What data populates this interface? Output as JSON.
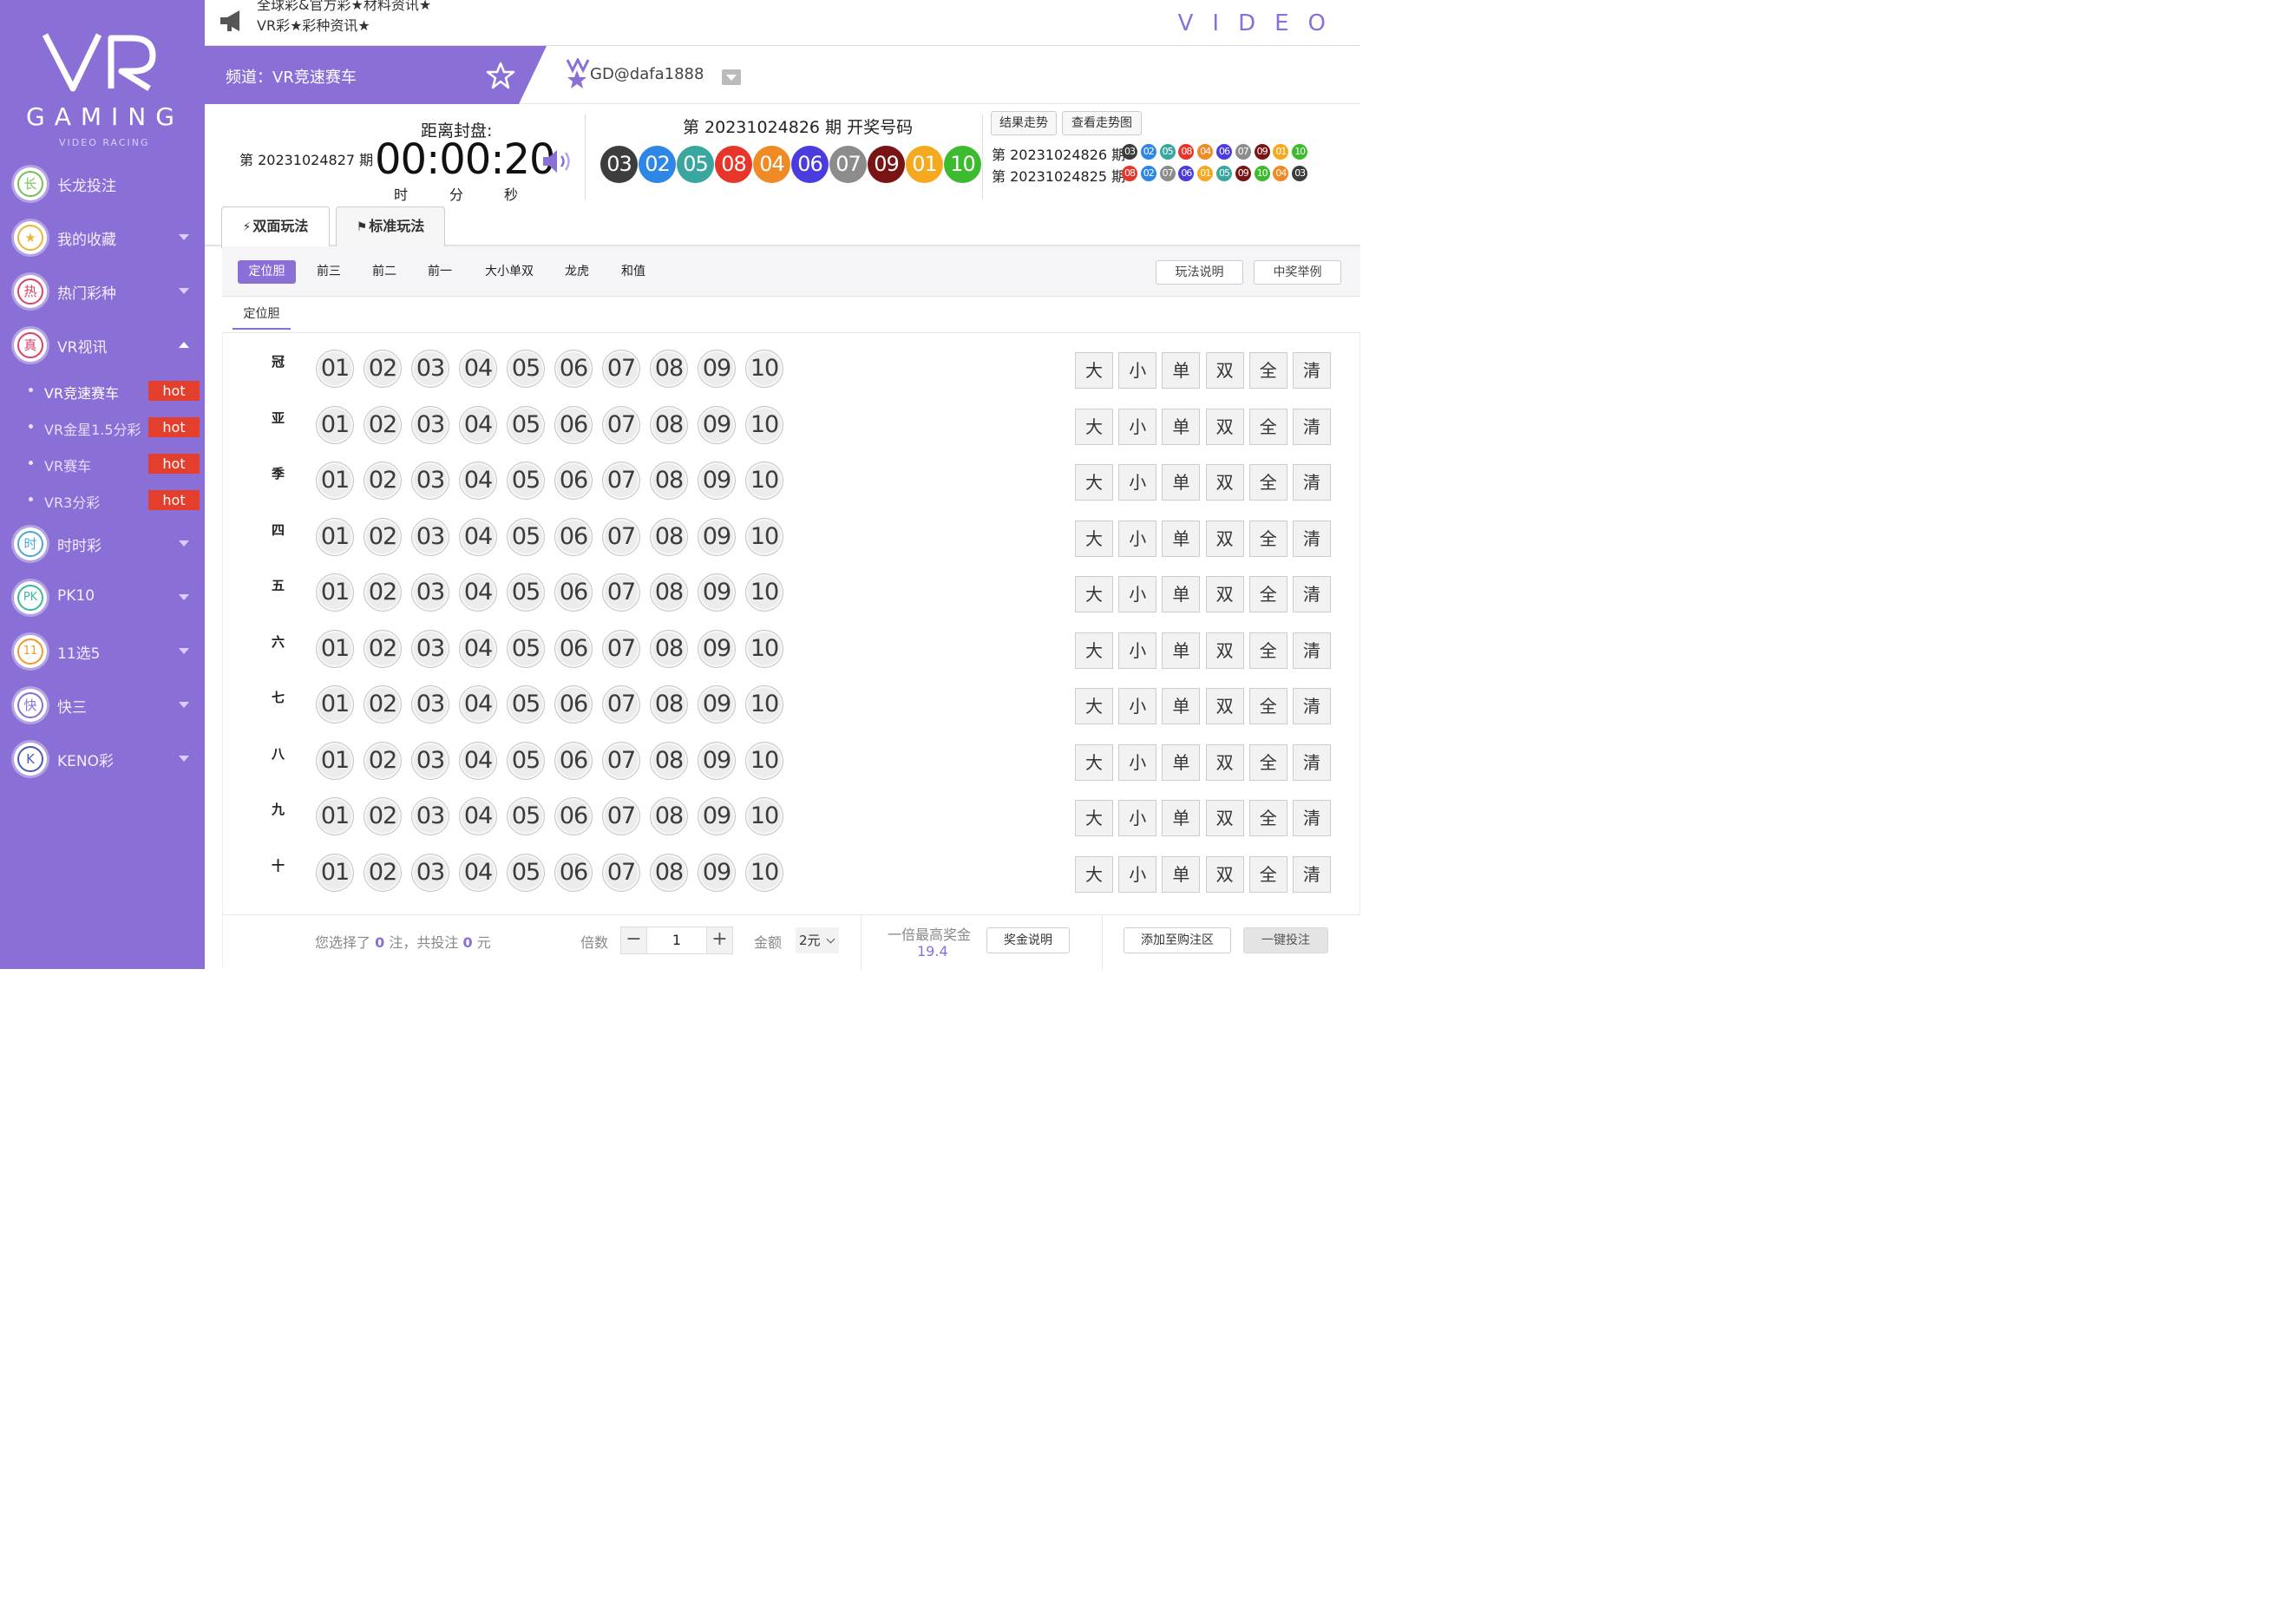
{
  "sidebar": {
    "logo_text": "GAMING",
    "logo_sub": "VIDEO RACING",
    "items": [
      {
        "icon_char": "长",
        "label": "长龙投注",
        "icon": "dragon-icon",
        "ring": "#77c05a",
        "arrow": "none"
      },
      {
        "icon_char": "★",
        "label": "我的收藏",
        "icon": "star-icon",
        "ring": "#e8b73a",
        "arrow": "down"
      },
      {
        "icon_char": "热",
        "label": "热门彩种",
        "icon": "fire-icon",
        "ring": "#d9436a",
        "arrow": "down"
      },
      {
        "icon_char": "真",
        "label": "VR视讯",
        "icon": "live-icon",
        "ring": "#d9436a",
        "arrow": "up"
      },
      {
        "icon_char": "时",
        "label": "时时彩",
        "icon": "clock-icon",
        "ring": "#4aa8d8",
        "arrow": "down"
      },
      {
        "icon_char": "PK",
        "label": "PK10",
        "icon": "pk-icon",
        "ring": "#3cb7a0",
        "arrow": "down"
      },
      {
        "icon_char": "11",
        "label": "11选5",
        "icon": "eleven-icon",
        "ring": "#ef9a2f",
        "arrow": "down"
      },
      {
        "icon_char": "快",
        "label": "快三",
        "icon": "dice-icon",
        "ring": "#8a70d6",
        "arrow": "down"
      },
      {
        "icon_char": "K",
        "label": "KENO彩",
        "icon": "keno-icon",
        "ring": "#4e5ab8",
        "arrow": "down"
      }
    ],
    "subitems": [
      {
        "label": "VR竞速赛车",
        "badge": "hot"
      },
      {
        "label": "VR金星1.5分彩",
        "badge": "hot"
      },
      {
        "label": "VR赛车",
        "badge": "hot"
      },
      {
        "label": "VR3分彩",
        "badge": "hot"
      }
    ]
  },
  "topbar": {
    "news_line1": "全球彩&官方彩★材料资讯★",
    "news_line2": "VR彩★彩种资讯★",
    "video_text": "VIDEO"
  },
  "channel": {
    "label": "频道：VR竞速赛车",
    "username": "GD@dafa1888"
  },
  "info": {
    "next_issue": "第 20231024827 期",
    "sealing_label": "距离封盘:",
    "countdown": "00:00:20",
    "unit_hour": "时",
    "unit_min": "分",
    "unit_sec": "秒",
    "draw_title": "第 20231024826 期  开奖号码",
    "draw_numbers": [
      {
        "n": "03",
        "c": "#3d3d3d"
      },
      {
        "n": "02",
        "c": "#2e86e6"
      },
      {
        "n": "05",
        "c": "#3aa6a0"
      },
      {
        "n": "08",
        "c": "#e8352a"
      },
      {
        "n": "04",
        "c": "#f08a24"
      },
      {
        "n": "06",
        "c": "#4b3ce0"
      },
      {
        "n": "07",
        "c": "#8c8c8c"
      },
      {
        "n": "09",
        "c": "#7a1414"
      },
      {
        "n": "01",
        "c": "#f5a91f"
      },
      {
        "n": "10",
        "c": "#3dbb2e"
      }
    ],
    "trend_btn": "结果走势",
    "chart_btn": "查看走势图",
    "history": [
      {
        "issue": "第 20231024826 期",
        "balls": [
          {
            "n": "03",
            "c": "#3d3d3d"
          },
          {
            "n": "02",
            "c": "#2e86e6"
          },
          {
            "n": "05",
            "c": "#3aa6a0"
          },
          {
            "n": "08",
            "c": "#e8352a"
          },
          {
            "n": "04",
            "c": "#f08a24"
          },
          {
            "n": "06",
            "c": "#4b3ce0"
          },
          {
            "n": "07",
            "c": "#8c8c8c"
          },
          {
            "n": "09",
            "c": "#7a1414"
          },
          {
            "n": "01",
            "c": "#f5a91f"
          },
          {
            "n": "10",
            "c": "#3dbb2e"
          }
        ]
      },
      {
        "issue": "第 20231024825 期",
        "balls": [
          {
            "n": "08",
            "c": "#e8352a"
          },
          {
            "n": "02",
            "c": "#2e86e6"
          },
          {
            "n": "07",
            "c": "#8c8c8c"
          },
          {
            "n": "06",
            "c": "#4b3ce0"
          },
          {
            "n": "01",
            "c": "#f5a91f"
          },
          {
            "n": "05",
            "c": "#3aa6a0"
          },
          {
            "n": "09",
            "c": "#7a1414"
          },
          {
            "n": "10",
            "c": "#3dbb2e"
          },
          {
            "n": "04",
            "c": "#f08a24"
          },
          {
            "n": "03",
            "c": "#3d3d3d"
          }
        ]
      }
    ]
  },
  "tabs": [
    {
      "label": "双面玩法",
      "icon": "lightning-icon"
    },
    {
      "label": "标准玩法",
      "icon": "flag-icon"
    }
  ],
  "subnav": {
    "items": [
      "定位胆",
      "前三",
      "前二",
      "前一",
      "大小单双",
      "龙虎",
      "和值"
    ],
    "help_btn": "玩法说明",
    "example_btn": "中奖举例",
    "subtab": "定位胆"
  },
  "grid": {
    "rows": [
      "冠",
      "亚",
      "季",
      "四",
      "五",
      "六",
      "七",
      "八",
      "九",
      "十"
    ],
    "numbers": [
      "01",
      "02",
      "03",
      "04",
      "05",
      "06",
      "07",
      "08",
      "09",
      "10"
    ],
    "quick": [
      "大",
      "小",
      "单",
      "双",
      "全",
      "清"
    ]
  },
  "footer": {
    "sel_prefix": "您选择了",
    "sel_count": "0",
    "sel_mid": "注，共投注",
    "sel_amount": "0",
    "sel_suffix": "元",
    "multiple_label": "倍数",
    "multiple_value": "1",
    "amount_label": "金额",
    "amount_value": "2元",
    "max_prize_label": "一倍最高奖金",
    "max_prize": "19.4",
    "prize_btn": "奖金说明",
    "add_btn": "添加至购注区",
    "quick_bet_btn": "一键投注"
  }
}
